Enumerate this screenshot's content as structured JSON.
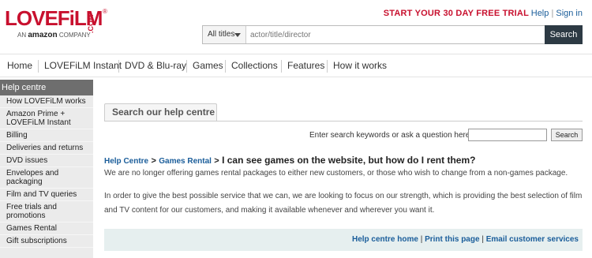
{
  "logo": {
    "word": "LOVEFiLM",
    "com": ".COM",
    "reg": "®",
    "sub_pre": "AN",
    "sub_brand": "amazon",
    "sub_post": "COMPANY"
  },
  "header": {
    "promo": "START YOUR 30 DAY FREE TRIAL",
    "help_link": "Help",
    "separator": "|",
    "signin_link": "Sign in"
  },
  "search": {
    "category": "All titles",
    "placeholder": "actor/title/director",
    "button": "Search"
  },
  "nav": [
    "Home",
    "LOVEFiLM Instant",
    "DVD & Blu-ray",
    "Games",
    "Collections",
    "Features",
    "How it works"
  ],
  "sidebar": {
    "title": "Help centre",
    "items": [
      "How LOVEFiLM works",
      "Amazon Prime + LOVEFiLM Instant",
      "Billing",
      "Deliveries and returns",
      "DVD issues",
      "Envelopes and packaging",
      "Film and TV queries",
      "Free trials and promotions",
      "Games Rental",
      "Gift subscriptions"
    ]
  },
  "help": {
    "tab": "Search our help centre",
    "keyword_label": "Enter search keywords or ask a question here:",
    "keyword_value": "",
    "search_button": "Search"
  },
  "article": {
    "crumb_1": "Help Centre",
    "crumb_2": "Games Rental",
    "crumb_sep": ">",
    "title": "I can see games on the website, but how do I rent them?",
    "para_1": "We are no longer offering games rental packages to either new customers, or those who wish to change from a non-games package.",
    "para_2": "In order to give the best possible service that we can, we are looking to focus on our strength, which is providing the best selection of film and TV content for our customers, and making it available whenever and wherever you want it."
  },
  "footer": {
    "link_1": "Help centre home",
    "link_2": "Print this page",
    "link_3": "Email customer services",
    "pipe": "|"
  },
  "colors": {
    "brand_red": "#c8102e",
    "link_blue": "#1a5d9a",
    "search_button": "#2d3a44",
    "sidebar_title_bg": "#6e6e6e"
  }
}
